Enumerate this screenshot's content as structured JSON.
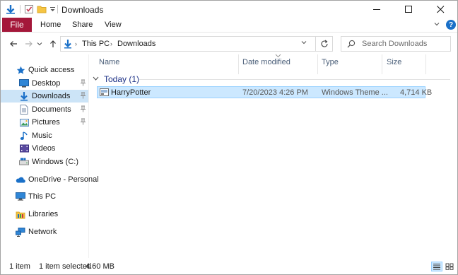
{
  "window": {
    "title": "Downloads",
    "controls": {
      "minimize": "—",
      "maximize": "☐",
      "close": "✕"
    }
  },
  "ribbon": {
    "file": "File",
    "tabs": [
      "Home",
      "Share",
      "View"
    ],
    "help": "?"
  },
  "nav": {
    "back": "←",
    "forward": "→",
    "recent": "⌄",
    "up": "↑",
    "breadcrumb": [
      "This PC",
      "Downloads"
    ],
    "search_placeholder": "Search Downloads"
  },
  "sidebar": {
    "items": [
      {
        "label": "Quick access",
        "icon": "star-icon",
        "pinned": false
      },
      {
        "label": "Desktop",
        "icon": "desktop-icon",
        "pinned": true
      },
      {
        "label": "Downloads",
        "icon": "download-icon",
        "pinned": true,
        "selected": true
      },
      {
        "label": "Documents",
        "icon": "documents-icon",
        "pinned": true
      },
      {
        "label": "Pictures",
        "icon": "pictures-icon",
        "pinned": true
      },
      {
        "label": "Music",
        "icon": "music-icon",
        "pinned": false
      },
      {
        "label": "Videos",
        "icon": "videos-icon",
        "pinned": false
      },
      {
        "label": "Windows (C:)",
        "icon": "drive-icon",
        "pinned": false
      },
      {
        "label": "OneDrive - Personal",
        "icon": "cloud-icon",
        "pinned": false
      },
      {
        "label": "This PC",
        "icon": "computer-icon",
        "pinned": false
      },
      {
        "label": "Libraries",
        "icon": "libraries-icon",
        "pinned": false
      },
      {
        "label": "Network",
        "icon": "network-icon",
        "pinned": false
      }
    ]
  },
  "files": {
    "columns": [
      "Name",
      "Date modified",
      "Type",
      "Size"
    ],
    "group": "Today (1)",
    "rows": [
      {
        "name": "HarryPotter",
        "date": "7/20/2023 4:26 PM",
        "type": "Windows Theme ...",
        "size": "4,714 KB",
        "icon": "theme-file-icon"
      }
    ]
  },
  "status": {
    "count": "1 item",
    "selected": "1 item selected",
    "size": "4.60 MB"
  },
  "colors": {
    "file_tab": "#a4173a",
    "selection": "#cce8ff",
    "selection_border": "#99d1ff",
    "nav_selected": "#cce4f7",
    "group_label": "#1e3287",
    "accent": "#1a70c8"
  }
}
